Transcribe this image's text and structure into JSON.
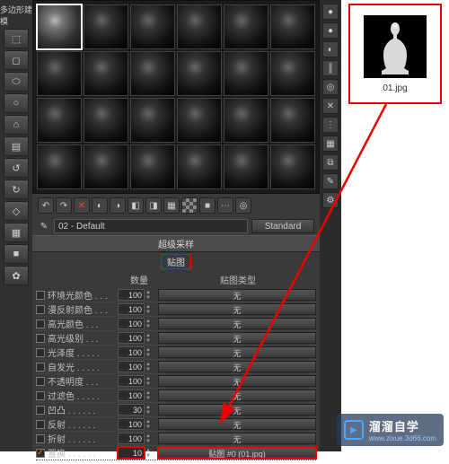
{
  "left_toolbar": {
    "label": "多边形建模",
    "tools": [
      "⬚",
      "◻",
      "⬭",
      "○",
      "⌂",
      "▤",
      "↺",
      "↻",
      "◇",
      "▦",
      "■",
      "✿"
    ]
  },
  "material": {
    "name": "02 - Default",
    "shader_btn": "Standard",
    "rollout_samples": "超级采样",
    "tab_maps": "贴图",
    "cols": {
      "name_header": "",
      "amount": "数量",
      "maptype": "贴图类型"
    },
    "rows": [
      {
        "enabled": false,
        "label": "环境光颜色 . . .",
        "amount": 100,
        "slot": "无"
      },
      {
        "enabled": false,
        "label": "漫反射颜色 . . .",
        "amount": 100,
        "slot": "无"
      },
      {
        "enabled": false,
        "label": "高光颜色 . . .",
        "amount": 100,
        "slot": "无"
      },
      {
        "enabled": false,
        "label": "高光级别 . . .",
        "amount": 100,
        "slot": "无"
      },
      {
        "enabled": false,
        "label": "光泽度 . . . . .",
        "amount": 100,
        "slot": "无"
      },
      {
        "enabled": false,
        "label": "自发光 . . . . .",
        "amount": 100,
        "slot": "无"
      },
      {
        "enabled": false,
        "label": "不透明度 . . .",
        "amount": 100,
        "slot": "无"
      },
      {
        "enabled": false,
        "label": "过滤色 . . . . .",
        "amount": 100,
        "slot": "无"
      },
      {
        "enabled": false,
        "label": "凹凸 . . . . . .",
        "amount": 30,
        "slot": "无"
      },
      {
        "enabled": false,
        "label": "反射 . . . . . .",
        "amount": 100,
        "slot": "无"
      },
      {
        "enabled": false,
        "label": "折射 . . . . . .",
        "amount": 100,
        "slot": "无"
      },
      {
        "enabled": true,
        "label": "置换 . . . . . .",
        "amount": 10,
        "slot": "贴图 #0 (01.jpg)",
        "hl": true
      }
    ]
  },
  "mat_toolbar": [
    "↶",
    "↷",
    "✕",
    "◐",
    "◑",
    "◧",
    "◨",
    "▦",
    "▩",
    "■",
    "⋯",
    "◎"
  ],
  "right_tools": [
    "●",
    "●",
    "◐",
    "║",
    "◎",
    "✕",
    "⋮",
    "▦",
    "⧉",
    "✎",
    "⚙"
  ],
  "file": {
    "name": "01.jpg"
  },
  "watermark": {
    "text": "溜溜自学",
    "sub": "www.zixue.3d66.com"
  }
}
